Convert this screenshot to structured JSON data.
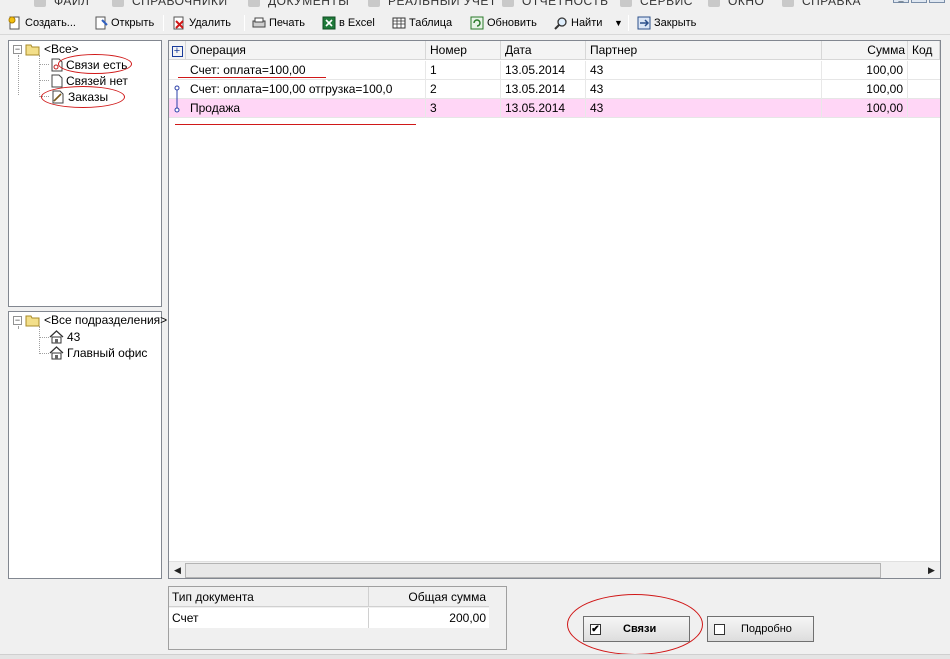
{
  "menu": {
    "items": [
      "ФАЙЛ",
      "СПРАВОЧНИКИ",
      "ДОКУМЕНТЫ",
      "РЕАЛЬНЫЙ УЧЕТ",
      "ОТЧЕТНОСТЬ",
      "СЕРВИС",
      "ОКНО",
      "СПРАВКА"
    ]
  },
  "toolbar": {
    "create": "Создать...",
    "open": "Открыть",
    "delete": "Удалить",
    "print": "Печать",
    "excel": "в Excel",
    "table": "Таблица",
    "refresh": "Обновить",
    "find": "Найти",
    "close": "Закрыть"
  },
  "tree1": {
    "root": "<Все>",
    "items": [
      "Связи есть",
      "Связей нет",
      "Заказы"
    ]
  },
  "tree2": {
    "root": "<Все подразделения>",
    "items": [
      "43",
      "Главный офис"
    ]
  },
  "grid": {
    "expand_symbol": "+",
    "columns": [
      "Операция",
      "Номер",
      "Дата",
      "Партнер",
      "Сумма",
      "Код"
    ],
    "rows": [
      {
        "operation": "Счет: оплата=100,00",
        "number": "1",
        "date": "13.05.2014",
        "partner": "43",
        "sum": "100,00"
      },
      {
        "operation": "Счет:  оплата=100,00  отгрузка=100,0",
        "number": "2",
        "date": "13.05.2014",
        "partner": "43",
        "sum": "100,00"
      },
      {
        "operation": "Продажа",
        "number": "3",
        "date": "13.05.2014",
        "partner": "43",
        "sum": "100,00"
      }
    ]
  },
  "summary": {
    "col_type": "Тип документа",
    "col_total": "Общая сумма",
    "row_type": "Счет",
    "row_total": "200,00"
  },
  "buttons": {
    "links_label": "Связи",
    "links_checked": true,
    "details_label": "Подробно",
    "details_checked": false
  },
  "colors": {
    "highlight_row": "#ffd6f6",
    "annotation": "#d01818",
    "link_connector": "#2a3fa8"
  }
}
